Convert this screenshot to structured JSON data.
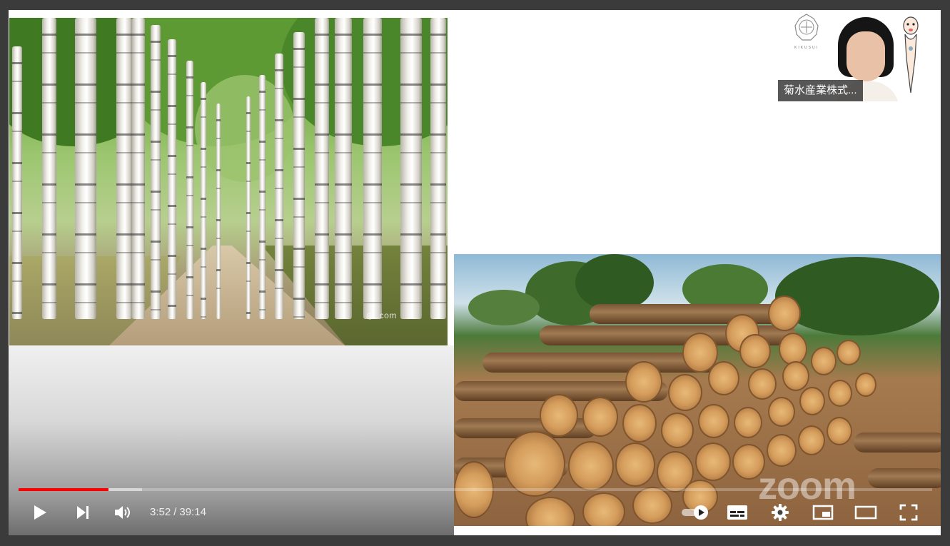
{
  "player": {
    "current_time": "3:52",
    "separator": "/",
    "duration": "39:14",
    "progress_played": 0.0984,
    "progress_buffered": 0.135,
    "accent_color": "#ff0000"
  },
  "controls": {
    "play": "play-icon",
    "next": "skip-next-icon",
    "volume": "volume-icon",
    "autoplay": "autoplay-toggle-icon",
    "subtitles": "subtitles-icon",
    "settings": "gear-icon",
    "miniplayer": "miniplayer-icon",
    "theater": "theater-mode-icon",
    "fullscreen": "fullscreen-icon"
  },
  "speaker": {
    "name": "菊水産業株式...",
    "logo_text": "KIKUSUI"
  },
  "slide": {
    "birch_watermark": "◎ .com",
    "zoom_watermark": "zoom"
  }
}
